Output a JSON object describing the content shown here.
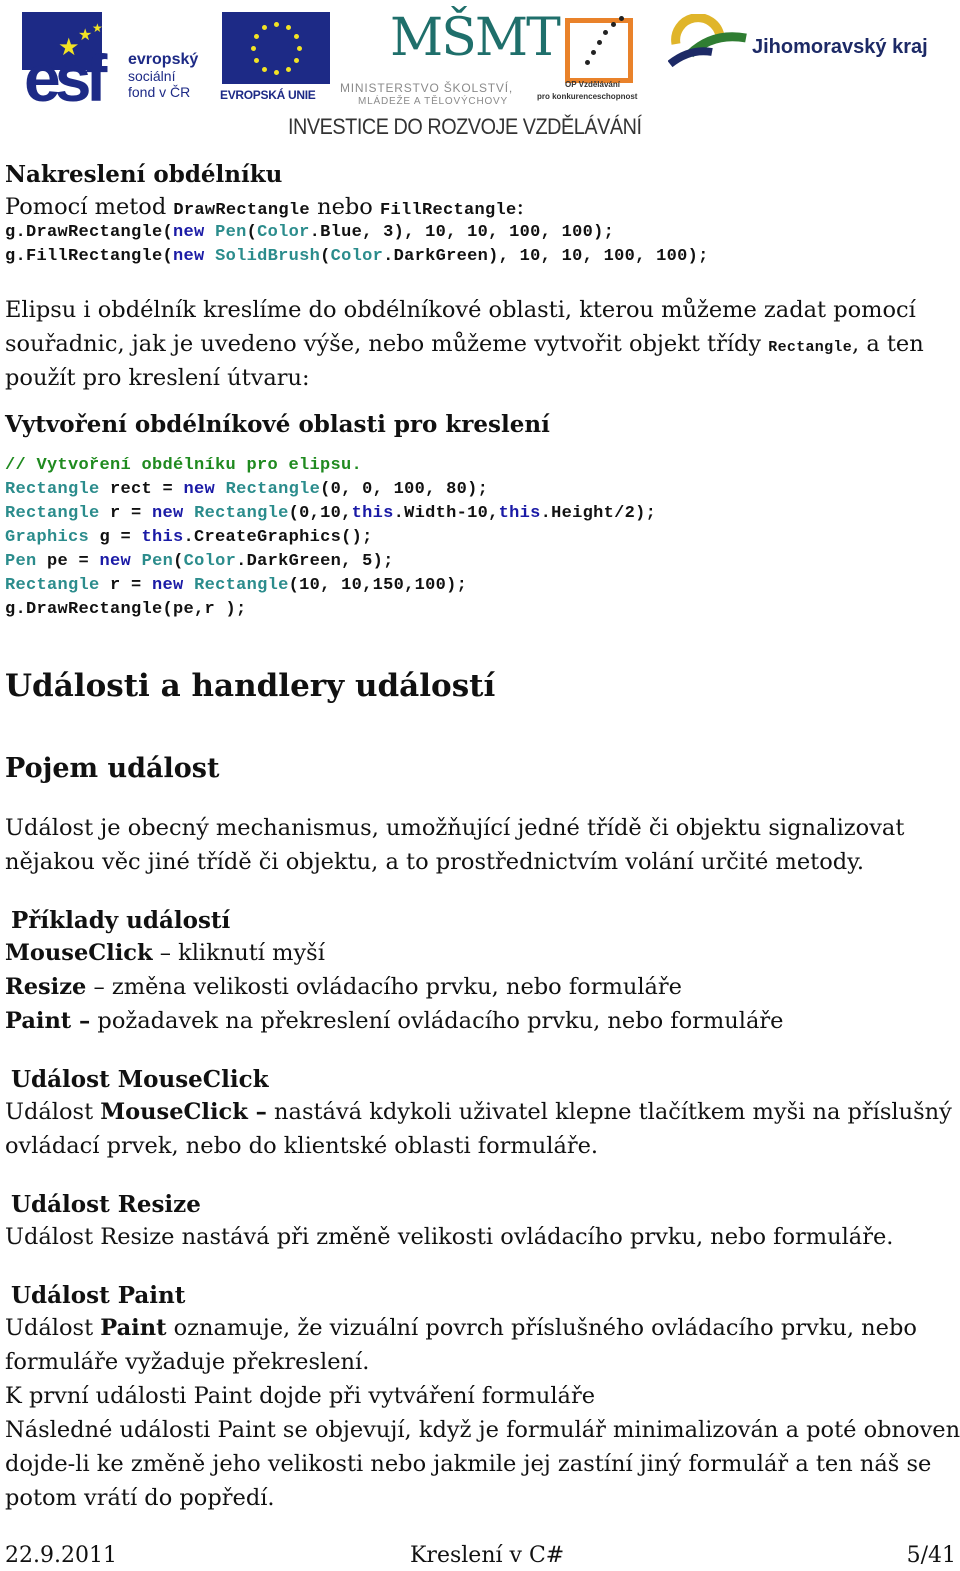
{
  "header": {
    "logos": {
      "esf": {
        "mark": "esf",
        "line1": "evropský",
        "line2": "sociální",
        "line3": "fond v ČR"
      },
      "eu": {
        "label": "EVROPSKÁ UNIE"
      },
      "msmt": {
        "mark": "MŠMT",
        "line1": "MINISTERSTVO ŠKOLSTVÍ,",
        "line2": "MLÁDEŽE A TĚLOVÝCHOVY"
      },
      "op": {
        "line1": "OP Vzdělávání",
        "line2": "pro konkurenceschopnost"
      },
      "jmk": {
        "label": "Jihomoravský kraj"
      }
    },
    "tagline": "INVESTICE DO ROZVOJE VZDĚLÁVÁNÍ",
    "colors": {
      "esf_blue": "#1d2a86",
      "eu_star": "#f2e324",
      "msmt_teal": "#1f6f6b",
      "op_orange": "#e9822a",
      "jmk_navy": "#1d2a66"
    }
  },
  "section_rect": {
    "heading": "Nakreslení obdélníku",
    "intro_prefix": "Pomocí metod ",
    "intro_method1": "DrawRectangle",
    "intro_mid": " nebo ",
    "intro_method2": "FillRectangle",
    "intro_suffix": ":",
    "code1": {
      "a": "g.DrawRectangle(",
      "kw": "new",
      "sp": " ",
      "ty1": "Pen",
      "b": "(",
      "ty2": "Color",
      "c": ".Blue, 3), 10, 10, 100, 100);"
    },
    "code2": {
      "a": "g.FillRectangle(",
      "kw": "new",
      "sp": " ",
      "ty1": "SolidBrush",
      "b": "(",
      "ty2": "Color",
      "c": ".DarkGreen), 10, 10, 100, 100);"
    }
  },
  "paragraph_ellipse": {
    "line1": "Elipsu i obdélník kreslíme do obdélníkové oblasti, kterou můžeme zadat pomocí",
    "line2_prefix": "souřadnic, jak je uvedeno výše, nebo můžeme vytvořit objekt třídy ",
    "line2_code": "Rectangle",
    "line2_suffix": ", a ten",
    "line3": "použít pro kreslení útvaru:"
  },
  "section_area": {
    "heading": "Vytvoření obdélníkové oblasti pro kreslení",
    "comment": "// Vytvoření obdélníku pro elipsu.",
    "lines": [
      {
        "ty": "Rectangle",
        "a": " rect = ",
        "kw": "new",
        "sp": " ",
        "ty2": "Rectangle",
        "b": "(0, 0, 100, 80);"
      },
      {
        "ty": "Rectangle",
        "a": " r = ",
        "kw": "new",
        "sp": " ",
        "ty2": "Rectangle",
        "b": "(0,10,",
        "kw2": "this",
        "c": ".Width-10,",
        "kw3": "this",
        "d": ".Height/2);"
      },
      {
        "ty": "Graphics",
        "a": " g = ",
        "kw": "this",
        "b": ".CreateGraphics();"
      },
      {
        "ty": "Pen",
        "a": " pe = ",
        "kw": "new",
        "sp": " ",
        "ty2": "Pen",
        "b": "(",
        "ty3": "Color",
        "c": ".DarkGreen, 5);"
      },
      {
        "ty": "Rectangle",
        "a": " r = ",
        "kw": "new",
        "sp": " ",
        "ty2": "Rectangle",
        "b": "(10, 10,150,100);"
      },
      {
        "a": "g.DrawRectangle(pe,r );"
      }
    ]
  },
  "events": {
    "title": "Události a handlery událostí",
    "concept_heading": "Pojem událost",
    "concept_line1": "Událost je obecný mechanismus, umožňující jedné třídě či objektu signalizovat",
    "concept_line2": "nějakou věc jiné třídě či objektu, a to prostřednictvím volání určité metody.",
    "examples_heading": "Příklady událostí",
    "examples": [
      {
        "name": "MouseClick",
        "desc": " – kliknutí myší"
      },
      {
        "name": "Resize",
        "desc": " – změna velikosti ovládacího prvku, nebo formuláře"
      },
      {
        "name": "Paint –",
        "desc": " požadavek na překreslení ovládacího prvku, nebo formuláře"
      }
    ],
    "mouseclick": {
      "heading": "Událost MouseClick",
      "l1_prefix": "Událost ",
      "l1_bold": "MouseClick –",
      "l1_suffix": " nastává kdykoli uživatel klepne tlačítkem myši na příslušný",
      "l2": "ovládací prvek, nebo do klientské oblasti formuláře."
    },
    "resize": {
      "heading": "Událost Resize",
      "l1": "Událost Resize nastává při změně velikosti ovládacího prvku, nebo formuláře."
    },
    "paint": {
      "heading": "Událost Paint",
      "l1_prefix": "Událost ",
      "l1_bold": "Paint",
      "l1_suffix": " oznamuje, že vizuální povrch příslušného ovládacího prvku, nebo",
      "l2": "formuláře vyžaduje překreslení.",
      "l3": "K první události Paint dojde při vytváření formuláře",
      "l4": "Následné události Paint se objevují, když je formulář minimalizován a poté obnoven,",
      "l5": "dojde-li ke změně jeho velikosti nebo jakmile jej zastíní jiný formulář a ten náš se",
      "l6": "potom vrátí do popředí."
    }
  },
  "footer": {
    "date": "22.9.2011",
    "title": "Kreslení v C#",
    "page": "5/41"
  }
}
